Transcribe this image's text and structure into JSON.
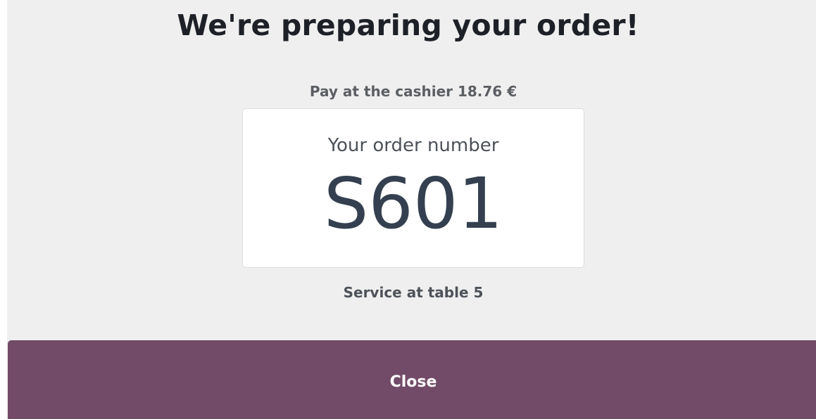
{
  "header": {
    "title": "We're preparing your order!"
  },
  "payment": {
    "text": "Pay at the cashier 18.76 €"
  },
  "order": {
    "label": "Your order number",
    "number": "S601"
  },
  "service": {
    "text": "Service at table 5"
  },
  "actions": {
    "close_label": "Close"
  },
  "colors": {
    "background": "#efefef",
    "accent": "#714b67",
    "card": "#ffffff",
    "title_text": "#1d2127",
    "order_number_text": "#34404f"
  }
}
